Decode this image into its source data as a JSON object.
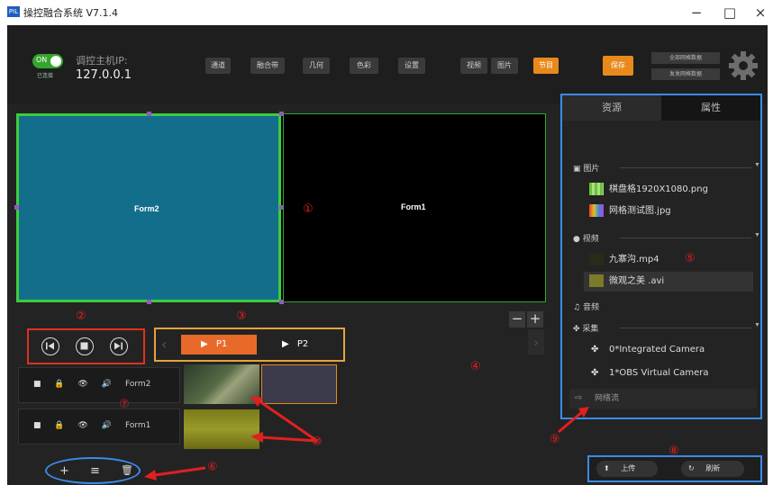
{
  "window": {
    "logo": "PIL",
    "title": "操控融合系统 V7.1.4",
    "minimize": "−",
    "maximize": "□",
    "close": "×"
  },
  "toolbar": {
    "toggle_label": "ON",
    "toggle_sub": "已连接",
    "ip_label": "调控主机IP:",
    "ip_value": "127.0.0.1",
    "buttons": [
      "通道",
      "融合带",
      "几何",
      "色彩",
      "设置"
    ],
    "view_buttons": [
      "视频",
      "图片"
    ],
    "project_button": "节目",
    "save_button": "保存",
    "small_buttons": [
      "全部网格数据",
      "发发网格数据"
    ],
    "settings_icon": "gear-icon"
  },
  "preview": {
    "form2_label": "Form2",
    "form1_label": "Form1"
  },
  "callouts": [
    "①",
    "②",
    "③",
    "④",
    "⑤",
    "⑥",
    "⑦",
    "⑧",
    "⑨",
    "⑩"
  ],
  "playback": {
    "prev_icon": "skip-previous-icon",
    "stop_icon": "stop-icon",
    "next_icon": "skip-next-icon"
  },
  "pages": {
    "items": [
      "P1",
      "P2"
    ],
    "active": 0
  },
  "zoom": {
    "minus": "−",
    "plus": "+"
  },
  "layers": [
    {
      "name": "Form2",
      "icons": [
        "square-icon",
        "lock-icon",
        "eye-icon",
        "speaker-icon"
      ]
    },
    {
      "name": "Form1",
      "icons": [
        "square-icon",
        "lock-icon",
        "eye-icon",
        "speaker-icon"
      ]
    }
  ],
  "bottom_tools": {
    "add": "+",
    "align": "≡",
    "delete": "🗑"
  },
  "panel": {
    "tabs": [
      "资源",
      "属性"
    ],
    "categories": {
      "images": "图片",
      "video": "视频",
      "audio": "音频",
      "capture": "采集",
      "stream": "网络流"
    },
    "image_items": [
      "棋盘格1920X1080.png",
      "网格测试图.jpg"
    ],
    "video_items": [
      "九寨沟.mp4",
      "微观之美 .avi"
    ],
    "capture_items": [
      "0*Integrated Camera",
      "1*OBS Virtual Camera"
    ],
    "upload": "上传",
    "refresh": "刷新"
  },
  "colors": {
    "accent_orange": "#e8891c",
    "toggle_green": "#35a52e",
    "frame_blue": "#3b8be8",
    "callout_red": "#e02020",
    "form2_bg": "#136e8c"
  }
}
